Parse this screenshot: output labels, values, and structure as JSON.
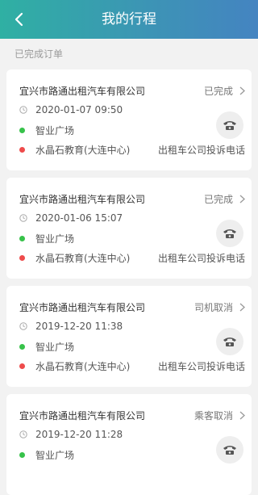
{
  "header": {
    "title": "我的行程",
    "back_icon": "chevron-left-icon"
  },
  "section_label": "已完成订单",
  "orders": [
    {
      "company": "宜兴市路通出租汽车有限公司",
      "status": "已完成",
      "time": "2020-01-07 09:50",
      "start": "智业广场",
      "end": "水晶石教育(大连中心)",
      "complaint": "出租车公司投诉电话"
    },
    {
      "company": "宜兴市路通出租汽车有限公司",
      "status": "已完成",
      "time": "2020-01-06 15:07",
      "start": "智业广场",
      "end": "水晶石教育(大连中心)",
      "complaint": "出租车公司投诉电话"
    },
    {
      "company": "宜兴市路通出租汽车有限公司",
      "status": "司机取消",
      "time": "2019-12-20 11:38",
      "start": "智业广场",
      "end": "水晶石教育(大连中心)",
      "complaint": "出租车公司投诉电话"
    },
    {
      "company": "宜兴市路通出租汽车有限公司",
      "status": "乘客取消",
      "time": "2019-12-20 11:28",
      "start": "智业广场",
      "end": "",
      "complaint": ""
    }
  ],
  "colors": {
    "header_start": "#2fb0a3",
    "header_end": "#4484c1",
    "start_dot": "#37c24a",
    "end_dot": "#ee4b4b"
  }
}
